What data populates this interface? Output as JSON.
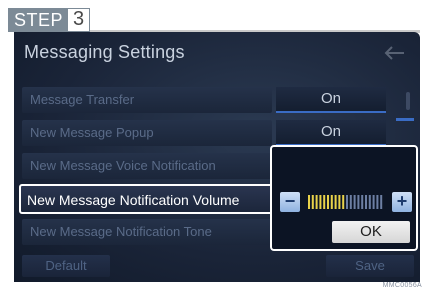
{
  "step": {
    "word": "STEP",
    "number": "3"
  },
  "screen": {
    "title": "Messaging Settings",
    "back_icon": "back-arrow-icon",
    "rows": [
      {
        "label": "Message Transfer"
      },
      {
        "label": "New Message Popup"
      },
      {
        "label": "New Message Voice Notification"
      },
      {
        "label": "New Message Notification Volume"
      },
      {
        "label": "New Message Notification Tone"
      }
    ],
    "values": {
      "message_transfer": "On",
      "new_message_popup": "On"
    },
    "popup": {
      "minus_label": "−",
      "plus_label": "+",
      "ok_label": "OK",
      "volume_level": 0.5
    },
    "buttons": {
      "default_label": "Default",
      "save_label": "Save"
    }
  },
  "watermark": "MMC0056A",
  "colors": {
    "screen_bg": "#1a2438",
    "accent_blue": "#3a6cc4",
    "highlight_border": "#ffffff",
    "volume_active": "#e8d24a",
    "volume_inactive": "#6d7fa3"
  }
}
